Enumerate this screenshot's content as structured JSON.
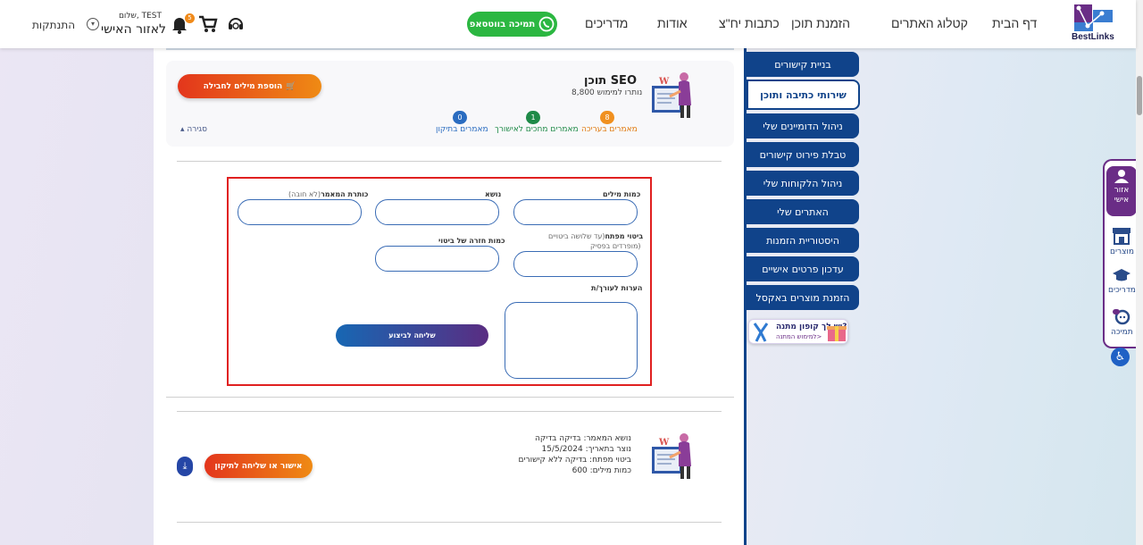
{
  "header": {
    "logo_text": "BestLinks",
    "nav": [
      {
        "label": "דף הבית"
      },
      {
        "label": "קטלוג האתרים"
      },
      {
        "label": "הזמנת תוכן"
      },
      {
        "label": "כתבות יח\"צ"
      },
      {
        "label": "אודות"
      },
      {
        "label": "מדריכים"
      }
    ],
    "whatsapp_label": "תמיכה בווטסאפ",
    "notifications_count": "5",
    "greeting": "שלום, TEST",
    "personal_area": "לאזור האישי",
    "logout": "התנתקות"
  },
  "seo": {
    "title": "תוכן SEO",
    "remaining": "נותרו למימוש 8,800",
    "add_words_button": "הוספת מילים לחבילה",
    "stats": [
      {
        "count": "8",
        "label": "מאמרים בעריכה",
        "color": "#f0901f"
      },
      {
        "count": "1",
        "label": "מאמרים מחכים לאישורך",
        "color": "#1f8a48"
      },
      {
        "count": "0",
        "label": "מאמרים בתיקון",
        "color": "#2a6cc0"
      }
    ],
    "close_label": "סגירה"
  },
  "form": {
    "word_count_label": "כמות מילים",
    "topic_label": "נושא",
    "article_title_label": "כותרת המאמר",
    "article_title_optional": "(לא חובה)",
    "keyword_label": "ביטוי מפתח",
    "keyword_hint_1": "(עד שלושה ביטויים",
    "keyword_hint_2": "מופרדים בפסיק)",
    "repeat_label": "כמות חזרה של ביטוי",
    "notes_label": "הערות לעורך/ת",
    "submit_label": "שליחה לביצוע"
  },
  "article": {
    "topic": "נושא המאמר: בדיקה בדיקה",
    "created": "נוצר בתאריך: 15/5/2024",
    "keyword": "ביטוי מפתח: בדיקה ללא קישורים",
    "words": "כמות מילים: 600",
    "approve_button": "אישור או שליחה לתיקון"
  },
  "sidebar": {
    "items": [
      {
        "label": "בניית קישורים"
      },
      {
        "label": "שירותי כתיבה ותוכן"
      },
      {
        "label": "ניהול הדומיינים שלי"
      },
      {
        "label": "טבלת פירוט קישורים"
      },
      {
        "label": "ניהול הלקוחות שלי"
      },
      {
        "label": "האתרים שלי"
      },
      {
        "label": "היסטוריית הזמנות"
      },
      {
        "label": "עדכון פרטים אישיים"
      },
      {
        "label": "הזמנת מוצרים באקסל"
      }
    ],
    "coupon_title": "יש לך קופון מתנה?",
    "coupon_sub": "למימוש המתנה>"
  },
  "dock": {
    "personal_1": "אזור",
    "personal_2": "אישי",
    "products": "מוצרים",
    "guides": "מדריכים",
    "support": "תמיכה"
  },
  "colors": {
    "primary_blue": "#10438a",
    "accent_orange": "#ef8a14",
    "accent_red": "#e3361c",
    "purple": "#6a2d86",
    "whatsapp_green": "#2bb741",
    "highlight_red": "#e02020"
  }
}
